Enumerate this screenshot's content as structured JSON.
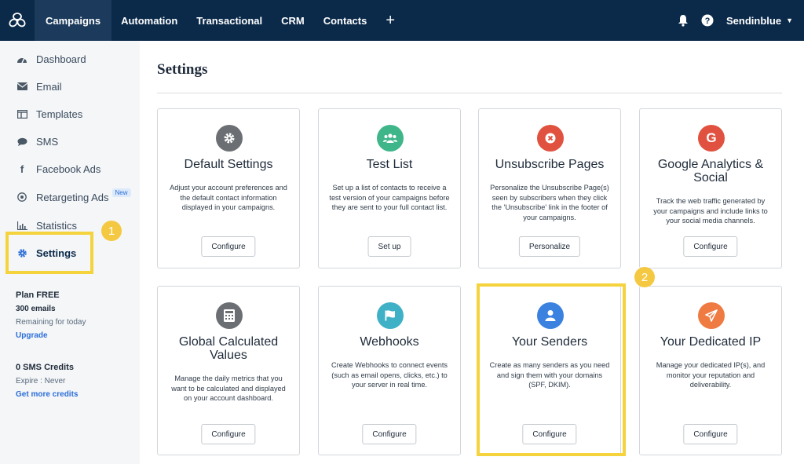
{
  "topnav": {
    "logo": "sendinblue-logo",
    "items": [
      {
        "label": "Campaigns",
        "active": true
      },
      {
        "label": "Automation"
      },
      {
        "label": "Transactional"
      },
      {
        "label": "CRM"
      },
      {
        "label": "Contacts"
      }
    ],
    "plus": "+",
    "account_label": "Sendinblue"
  },
  "sidebar": {
    "items": [
      {
        "label": "Dashboard",
        "icon": "dashboard-icon"
      },
      {
        "label": "Email",
        "icon": "envelope-icon"
      },
      {
        "label": "Templates",
        "icon": "template-icon"
      },
      {
        "label": "SMS",
        "icon": "chat-icon"
      },
      {
        "label": "Facebook Ads",
        "icon": "facebook-icon"
      },
      {
        "label": "Retargeting Ads",
        "icon": "target-icon",
        "badge": "New"
      },
      {
        "label": "Statistics",
        "icon": "chart-icon"
      },
      {
        "label": "Settings",
        "icon": "gear-icon",
        "active": true
      }
    ],
    "plan": {
      "title": "Plan FREE",
      "emails": "300 emails",
      "remaining": "Remaining for today",
      "upgrade": "Upgrade"
    },
    "sms": {
      "title": "0 SMS Credits",
      "expire": "Expire : Never",
      "link": "Get more credits"
    }
  },
  "annotations": {
    "step1": "1",
    "step2": "2",
    "highlight_color": "#f5d33d"
  },
  "main": {
    "title": "Settings",
    "cards": [
      {
        "title": "Default Settings",
        "desc": "Adjust your account preferences and the default contact information displayed in your campaigns.",
        "button": "Configure",
        "icon": "gear-icon",
        "color": "#6b6f74"
      },
      {
        "title": "Test List",
        "desc": "Set up a list of contacts to receive a test version of your campaigns before they are sent to your full contact list.",
        "button": "Set up",
        "icon": "group-icon",
        "color": "#3fb58a"
      },
      {
        "title": "Unsubscribe Pages",
        "desc": "Personalize the Unsubscribe Page(s) seen by subscribers when they click the 'Unsubscribe' link in the footer of your campaigns.",
        "button": "Personalize",
        "icon": "close-circle-icon",
        "color": "#e0523f"
      },
      {
        "title": "Google Analytics & Social",
        "desc": "Track the web traffic generated by your campaigns and include links to your social media channels.",
        "button": "Configure",
        "icon": "google-icon",
        "color": "#e0523f"
      },
      {
        "title": "Global Calculated Values",
        "desc": "Manage the daily metrics that you want to be calculated and displayed on your account dashboard.",
        "button": "Configure",
        "icon": "calculator-icon",
        "color": "#6b6f74"
      },
      {
        "title": "Webhooks",
        "desc": "Create Webhooks to connect events (such as email opens, clicks, etc.) to your server in real time.",
        "button": "Configure",
        "icon": "flag-icon",
        "color": "#3fb1c6"
      },
      {
        "title": "Your Senders",
        "desc": "Create as many senders as you need and sign them with your domains (SPF, DKIM).",
        "button": "Configure",
        "icon": "user-icon",
        "color": "#3b82e0"
      },
      {
        "title": "Your Dedicated IP",
        "desc": "Manage your dedicated IP(s), and monitor your reputation and deliverability.",
        "button": "Configure",
        "icon": "paper-plane-icon",
        "color": "#ef7a42"
      }
    ]
  }
}
